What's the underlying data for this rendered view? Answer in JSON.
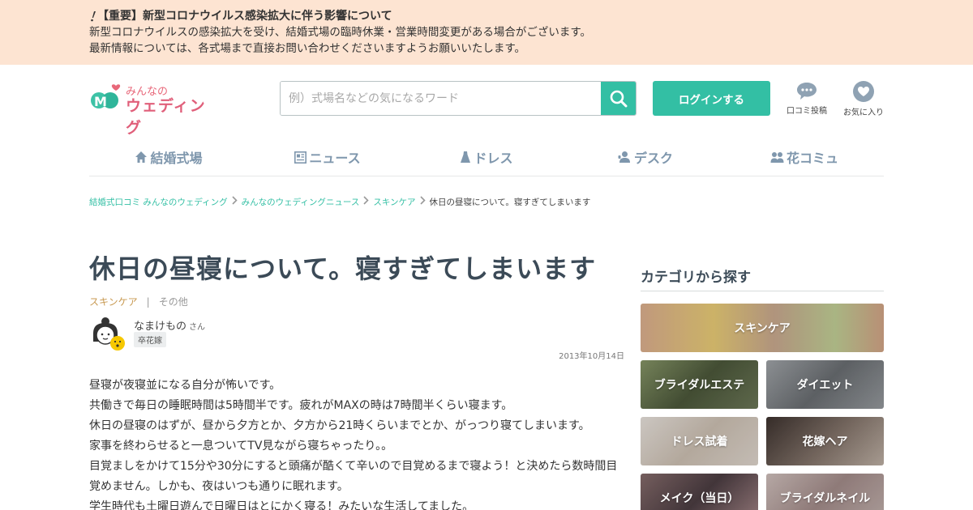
{
  "notice": {
    "icon": "exclamation-icon",
    "title": "【重要】新型コロナウイルス感染拡大に伴う影響について",
    "line1": "新型コロナウイルスの感染拡大を受け、結婚式場の臨時休業・営業時間変更がある場合がございます。",
    "line2": "最新情報については、各式場まで直接お問い合わせくださいますようお願いいたします。",
    "bg_color": "#fde4d2"
  },
  "header": {
    "logo_line1": "みんなの",
    "logo_line2": "ウェディング",
    "search_placeholder": "例）式場名などの気になるワード",
    "search_icon": "search-icon",
    "login_label": "ログインする",
    "review_post_label": "口コミ投稿",
    "favorites_label": "お気に入り",
    "accent_color": "#33bfa4"
  },
  "nav": {
    "items": [
      {
        "label": "結婚式場",
        "icon": "chapel-icon"
      },
      {
        "label": "ニュース",
        "icon": "news-icon"
      },
      {
        "label": "ドレス",
        "icon": "dress-icon"
      },
      {
        "label": "デスク",
        "icon": "desk-icon"
      },
      {
        "label": "花コミュ",
        "icon": "community-icon"
      }
    ]
  },
  "breadcrumb": {
    "items": [
      "結婚式口コミ みんなのウェディング",
      "みんなのウェディングニュース",
      "スキンケア"
    ],
    "current": "休日の昼寝について。寝すぎてしまいます"
  },
  "article": {
    "title": "休日の昼寝について。寝すぎてしまいます",
    "category1": "スキンケア",
    "separator": "|",
    "category2": "その他",
    "author_name": "なまけもの",
    "author_suffix": "さん",
    "author_badge": "卒花嫁",
    "date": "2013年10月14日",
    "paragraphs": [
      "昼寝が夜寝並になる自分が怖いです。",
      "共働きで毎日の睡眠時間は5時間半です。疲れがMAXの時は7時間半くらい寝ます。",
      "休日の昼寝のはずが、昼から夕方とか、夕方から21時くらいまでとか、がっつり寝てしまいます。",
      "家事を終わらせると一息ついてTV見ながら寝ちゃったり。。",
      "目覚ましをかけて15分や30分にすると頭痛が酷くて辛いので目覚めるまで寝よう！と決めたら数時間目",
      "覚めません。しかも、夜はいつも通りに眠れます。",
      "学生時代も土曜日遊んで日曜日はとにかく寝る！みたいな生活してました。"
    ]
  },
  "sidebar": {
    "title": "カテゴリから探す",
    "tiles": [
      {
        "label": "スキンケア",
        "color": "#d9a98a"
      },
      {
        "label": "ブライダルエステ",
        "color": "#5d6a4a"
      },
      {
        "label": "ダイエット",
        "color": "#8a8f93"
      },
      {
        "label": "ドレス試着",
        "color": "#d8d2cc"
      },
      {
        "label": "花嫁ヘア",
        "color": "#6b5a52"
      },
      {
        "label": "メイク（当日）",
        "color": "#6a5a5e"
      },
      {
        "label": "ブライダルネイル",
        "color": "#b8a8a6"
      }
    ]
  }
}
